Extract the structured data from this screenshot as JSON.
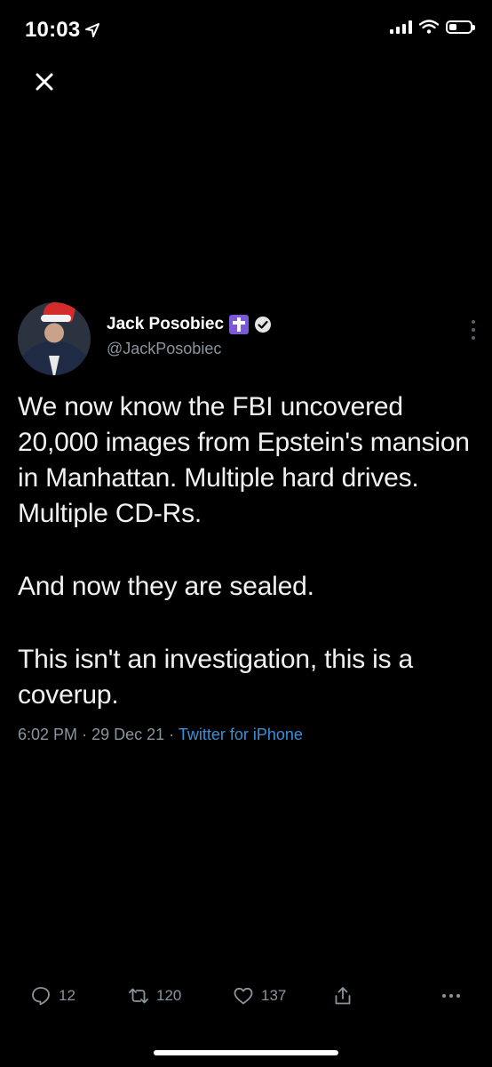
{
  "status_bar": {
    "time": "10:03",
    "location_icon": "location-arrow-icon",
    "signal_icon": "cellular-signal-icon",
    "wifi_icon": "wifi-icon",
    "battery_icon": "battery-icon",
    "battery_level": 0.35
  },
  "header": {
    "close_icon": "close-icon"
  },
  "tweet": {
    "display_name": "Jack Posobiec",
    "handle": "@JackPosobiec",
    "badge_icon": "cross-badge-icon",
    "verified_icon": "verified-badge-icon",
    "more_icon": "more-vertical-icon",
    "paragraphs": [
      "We now know the FBI uncovered 20,000 images from Epstein's mansion in Manhattan. Multiple hard drives. Multiple CD-Rs.",
      "And now they are sealed.",
      "This isn't an investigation, this is a coverup."
    ],
    "time": "6:02 PM",
    "date": "29 Dec 21",
    "separator": "·",
    "source": "Twitter for iPhone"
  },
  "actions": {
    "reply_count": "12",
    "retweet_count": "120",
    "like_count": "137",
    "reply_icon": "reply-icon",
    "retweet_icon": "retweet-icon",
    "like_icon": "heart-icon",
    "share_icon": "share-icon",
    "more_icon": "more-horizontal-icon"
  },
  "colors": {
    "background": "#000000",
    "text": "#f1f1f1",
    "secondary": "#8b949e",
    "link": "#3b8fd8",
    "badge_purple": "#7a5ad6"
  }
}
